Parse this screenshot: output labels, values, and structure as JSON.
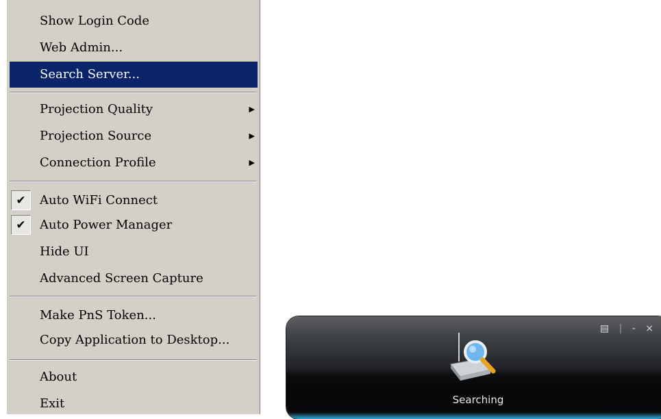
{
  "menu": {
    "items": [
      {
        "label": "Show Login Code"
      },
      {
        "label": "Web Admin..."
      },
      {
        "label": "Search Server...",
        "selected": true
      },
      {
        "label": "Projection Quality",
        "submenu": true
      },
      {
        "label": "Projection Source",
        "submenu": true
      },
      {
        "label": "Connection Profile",
        "submenu": true
      },
      {
        "label": "Auto WiFi Connect",
        "checked": true
      },
      {
        "label": "Auto Power Manager",
        "checked": true
      },
      {
        "label": "Hide UI"
      },
      {
        "label": "Advanced Screen Capture"
      },
      {
        "label": "Make PnS Token..."
      },
      {
        "label": "Copy Application to Desktop..."
      },
      {
        "label": "About"
      },
      {
        "label": "Exit"
      }
    ],
    "arrow_glyph": "▶",
    "check_glyph": "✔"
  },
  "app_panel": {
    "status": "Searching",
    "icon": "search-server-icon",
    "controls": {
      "menu_glyph": "▤",
      "divider": "|",
      "minimize_glyph": "-",
      "close_glyph": "×"
    }
  },
  "colors": {
    "menu_bg": "#d4d0c8",
    "selection": "#0a246a",
    "panel_glow": "#2fa9d8"
  }
}
